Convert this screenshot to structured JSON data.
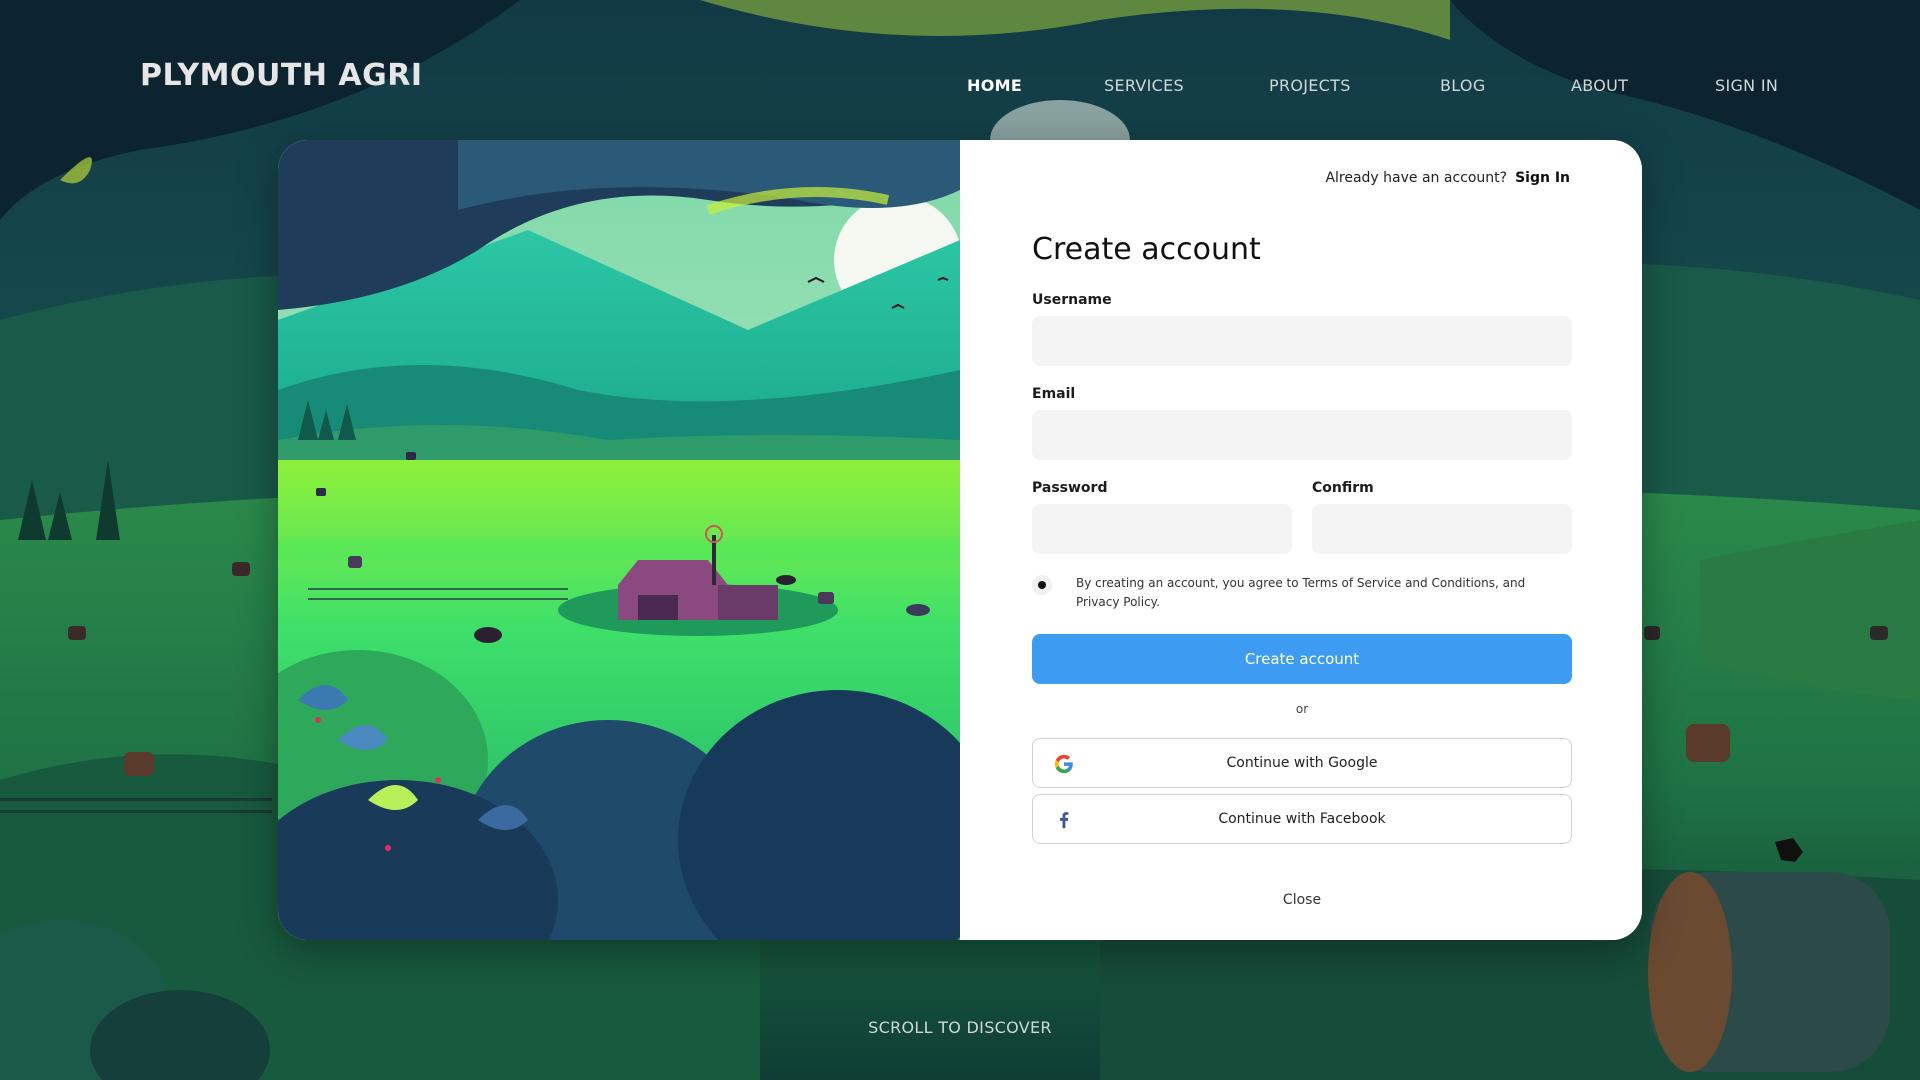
{
  "brand": {
    "name": "PLYMOUTH AGRI"
  },
  "nav": {
    "items": [
      {
        "label": "HOME",
        "active": true
      },
      {
        "label": "SERVICES",
        "active": false
      },
      {
        "label": "PROJECTS",
        "active": false
      },
      {
        "label": "BLOG",
        "active": false
      },
      {
        "label": "ABOUT",
        "active": false
      },
      {
        "label": "SIGN IN",
        "active": false
      }
    ]
  },
  "modal": {
    "signin_prompt": "Already have an account?",
    "signin_link": "Sign In",
    "title": "Create account",
    "fields": {
      "username": {
        "label": "Username",
        "value": ""
      },
      "email": {
        "label": "Email",
        "value": ""
      },
      "password": {
        "label": "Password",
        "value": ""
      },
      "confirm": {
        "label": "Confirm",
        "value": ""
      }
    },
    "terms": {
      "text": "By creating an account, you agree to Terms of Service and Conditions, and Privacy Policy.",
      "checked": true
    },
    "submit_label": "Create account",
    "divider_text": "or",
    "social": {
      "google": {
        "label": "Continue with Google",
        "icon": "google-icon"
      },
      "facebook": {
        "label": "Continue with Facebook",
        "icon": "facebook-icon"
      }
    },
    "close_label": "Close"
  },
  "scroll_cue": "SCROLL TO DISCOVER",
  "colors": {
    "accent_blue": "#3d9cf2",
    "facebook_blue": "#3b5998",
    "scene_green": "#2fd07a",
    "scene_dark": "#0b2a30"
  }
}
